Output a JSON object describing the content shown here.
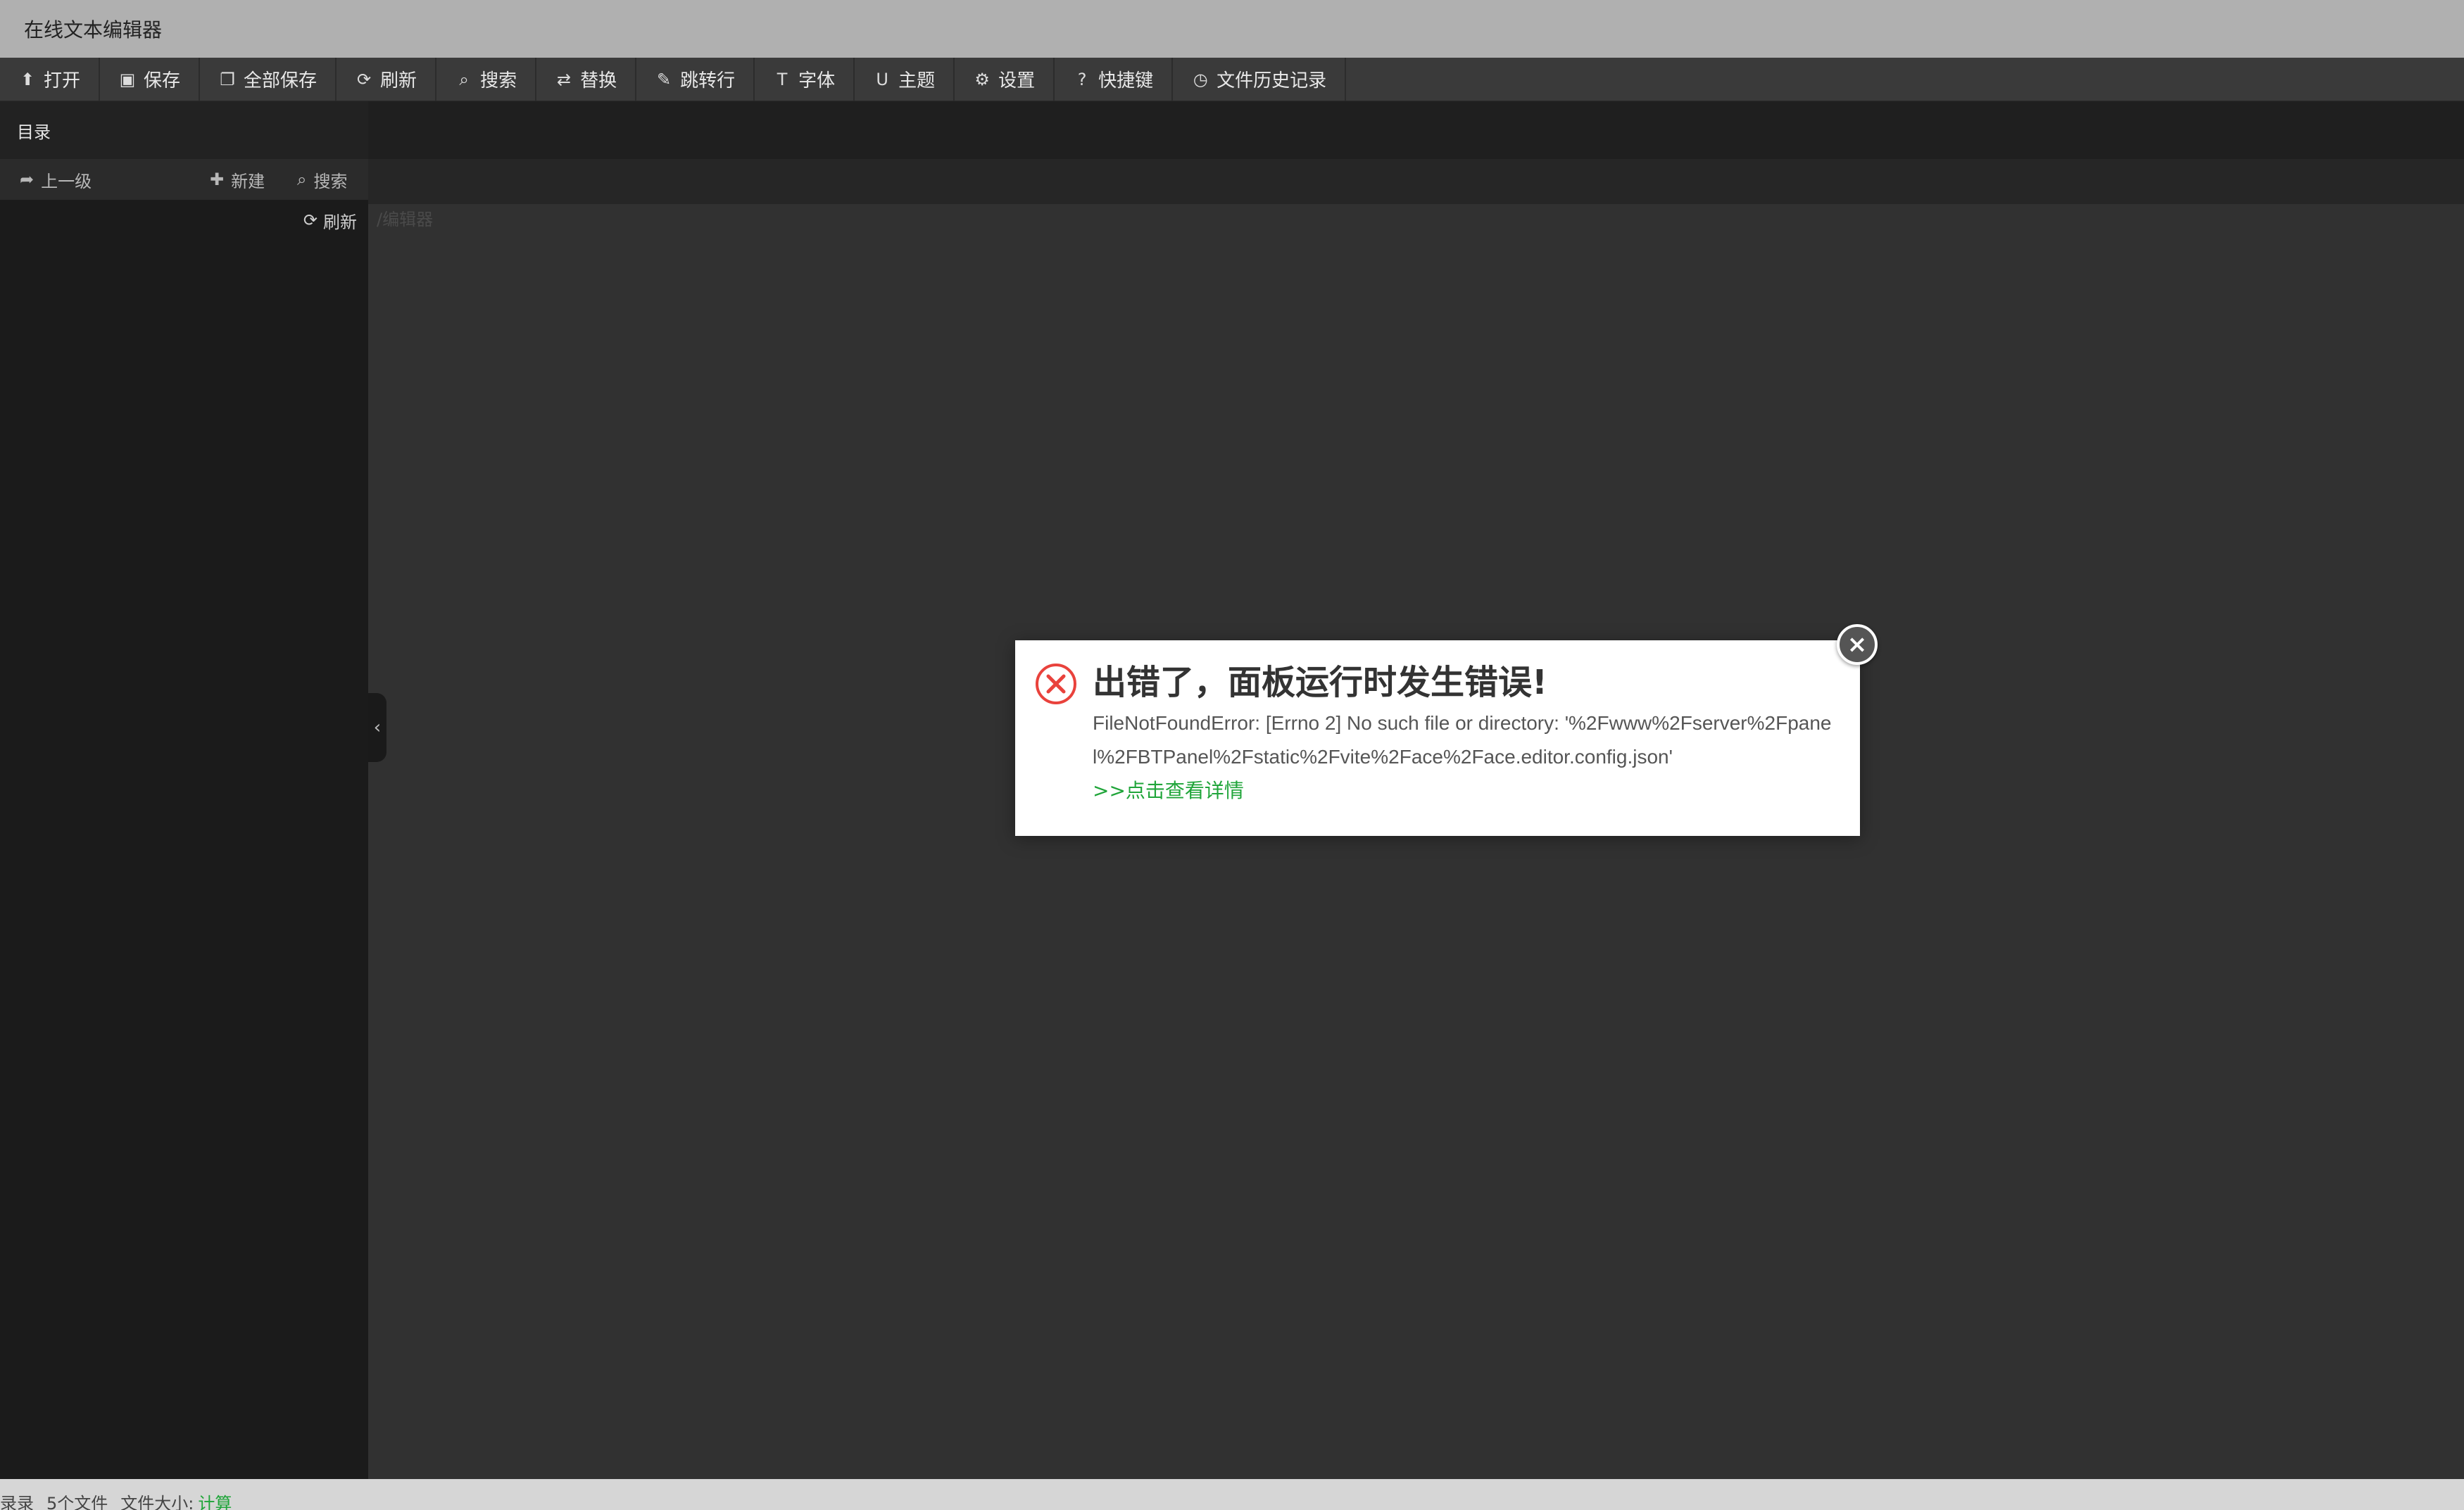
{
  "window": {
    "title": "在线文本编辑器"
  },
  "toolbar": {
    "items": [
      {
        "label": "打开",
        "icon": "upload-icon",
        "glyph": "⬆"
      },
      {
        "label": "保存",
        "icon": "floppy-icon",
        "glyph": "▣"
      },
      {
        "label": "全部保存",
        "icon": "copy-icon",
        "glyph": "❐"
      },
      {
        "label": "刷新",
        "icon": "refresh-icon",
        "glyph": "⟳"
      },
      {
        "label": "搜索",
        "icon": "search-icon",
        "glyph": "⌕"
      },
      {
        "label": "替换",
        "icon": "retweet-icon",
        "glyph": "⇄"
      },
      {
        "label": "跳转行",
        "icon": "pin-icon",
        "glyph": "✎"
      },
      {
        "label": "字体",
        "icon": "text-icon",
        "glyph": "T"
      },
      {
        "label": "主题",
        "icon": "magnet-icon",
        "glyph": "U"
      },
      {
        "label": "设置",
        "icon": "gear-icon",
        "glyph": "⚙"
      },
      {
        "label": "快捷键",
        "icon": "question-icon",
        "glyph": "?"
      },
      {
        "label": "文件历史记录",
        "icon": "clock-icon",
        "glyph": "◷"
      }
    ]
  },
  "sidebar": {
    "title": "目录",
    "up_label": "上一级",
    "new_label": "新建",
    "search_label": "搜索",
    "refresh_label": "刷新"
  },
  "editor": {
    "hint": "/编辑器"
  },
  "statusbar": {
    "path": "录录",
    "file_count": "5个文件",
    "size_label": "文件大小:",
    "calc_link": "计算"
  },
  "dialog": {
    "title": "出错了，面板运行时发生错误!",
    "message": "FileNotFoundError: [Errno 2] No such file or directory: '%2Fwww%2Fserver%2Fpanel%2FBTPanel%2Fstatic%2Fvite%2Face%2Face.editor.config.json'",
    "detail_link": ">>点击查看详情",
    "close_glyph": "×"
  },
  "colors": {
    "accent_green": "#20a53a",
    "error_red": "#e9423c",
    "titlebar": "#b0b0b0",
    "toolbar": "#3a3a3a",
    "sidebar": "#1b1b1b",
    "editor": "#313131"
  }
}
